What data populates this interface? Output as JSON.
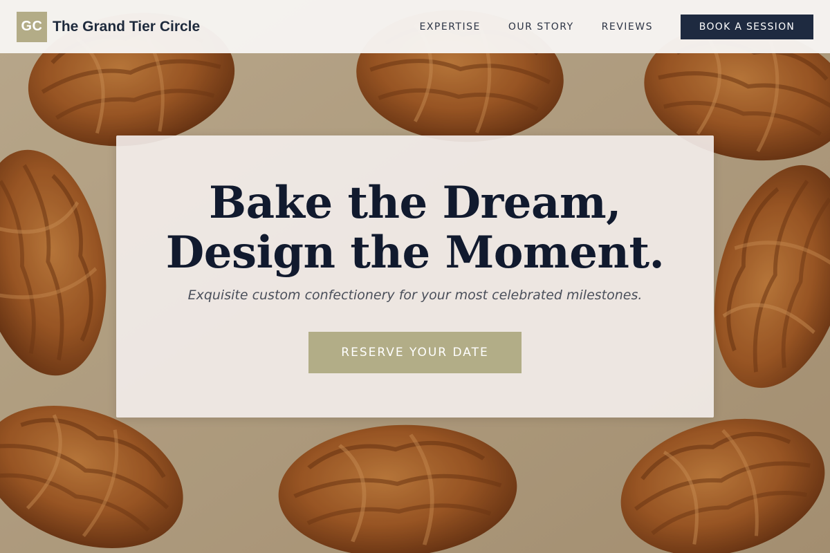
{
  "header": {
    "logo_initials": "GC",
    "brand_name": "The Grand Tier Circle",
    "nav": [
      {
        "label": "EXPERTISE"
      },
      {
        "label": "OUR STORY"
      },
      {
        "label": "REVIEWS"
      }
    ],
    "cta_label": "BOOK A SESSION"
  },
  "hero": {
    "title_line1": "Bake the Dream,",
    "title_line2": "Design the Moment.",
    "subtitle": "Exquisite custom confectionery for your most celebrated milestones.",
    "cta_label": "RESERVE YOUR DATE",
    "background_image": "croissants-on-baking-sheet"
  },
  "colors": {
    "navy": "#1e2a40",
    "gold_accent": "#b2ad87",
    "card_bg": "#f4eeec",
    "header_bg": "#f7f5f3",
    "heading_text": "#111a2e"
  }
}
